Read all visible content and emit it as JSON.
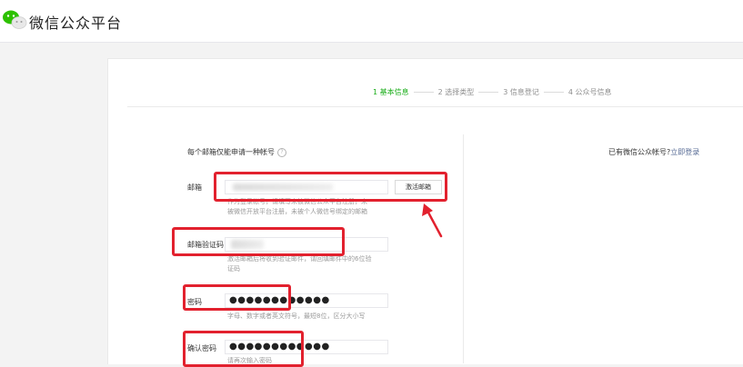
{
  "header": {
    "brand": "微信公众平台",
    "logo_icon": "wechat-logo-icon"
  },
  "steps": [
    {
      "label": "1 基本信息",
      "active": true
    },
    {
      "label": "2 选择类型",
      "active": false
    },
    {
      "label": "3 信息登记",
      "active": false
    },
    {
      "label": "4 公众号信息",
      "active": false
    }
  ],
  "form": {
    "intro": "每个邮箱仅能申请一种帐号",
    "login_hint": "已有微信公众帐号?",
    "login_link": "立即登录",
    "email": {
      "label": "邮箱",
      "button": "激活邮箱",
      "tip_line1": "作为登录帐号，请填写未被微信公众平台注册，未",
      "tip_line2": "被微信开放平台注册，未被个人微信号绑定的邮箱"
    },
    "code": {
      "label": "邮箱验证码",
      "tip_line1": "激活邮箱后将收到验证邮件，请回填邮件中的6位验",
      "tip_line2": "证码"
    },
    "password": {
      "label": "密码",
      "value": "●●●●●●●●●●●●",
      "tip": "字母、数字或者英文符号，最短8位，区分大小写"
    },
    "confirm": {
      "label": "确认密码",
      "value": "●●●●●●●●●●●●",
      "tip": "请再次输入密码"
    }
  },
  "colors": {
    "accent": "#1aad19",
    "annotation": "#e2212e",
    "link": "#576b95"
  }
}
